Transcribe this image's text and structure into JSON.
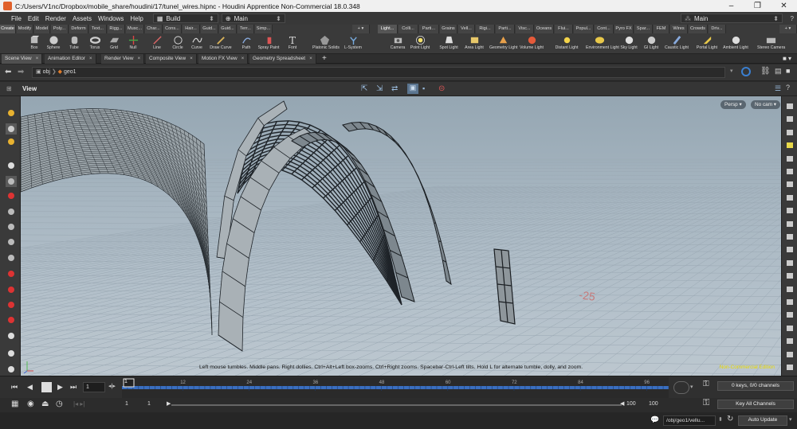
{
  "window": {
    "title": "C:/Users/V1nc/Dropbox/mobile_share/houdini/17/tunel_wires.hipnc - Houdini Apprentice Non-Commercial 18.0.348",
    "minimize": "–",
    "maximize": "❐",
    "close": "✕"
  },
  "menu": {
    "items": [
      "File",
      "Edit",
      "Render",
      "Assets",
      "Windows",
      "Help"
    ],
    "desktop": "Build",
    "desktop_ctx": "Main",
    "right_desktop": "Main"
  },
  "shelf_tabs_left": [
    "Create",
    "Modify",
    "Model",
    "Poly...",
    "Deform",
    "Text...",
    "Rigg...",
    "Musc...",
    "Char...",
    "Cons...",
    "Hair...",
    "Guid...",
    "Guid...",
    "Terr...",
    "Simp..."
  ],
  "shelf_tabs_right": [
    "Light...",
    "Colli...",
    "Parti...",
    "Grains",
    "Vell...",
    "Rigi...",
    "Parti...",
    "Visc...",
    "Oceans",
    "Flui...",
    "Popul...",
    "Cont...",
    "Pyro FX",
    "Spar...",
    "FEM",
    "Wires",
    "Crowds",
    "Driv..."
  ],
  "tools_left": [
    {
      "label": "Box",
      "icon": "box-icon"
    },
    {
      "label": "Sphere",
      "icon": "sphere-icon"
    },
    {
      "label": "Tube",
      "icon": "tube-icon"
    },
    {
      "label": "Torus",
      "icon": "torus-icon"
    },
    {
      "label": "Grid",
      "icon": "grid-icon"
    },
    {
      "label": "Null",
      "icon": "null-icon"
    },
    {
      "label": "Line",
      "icon": "line-icon"
    },
    {
      "label": "Circle",
      "icon": "circle-icon"
    },
    {
      "label": "Curve",
      "icon": "curve-icon"
    },
    {
      "label": "Draw Curve",
      "icon": "draw-curve-icon"
    },
    {
      "label": "Path",
      "icon": "path-icon"
    },
    {
      "label": "Spray Paint",
      "icon": "spray-paint-icon"
    },
    {
      "label": "Font",
      "icon": "font-icon"
    },
    {
      "label": "Platonic Solids",
      "icon": "platonic-icon"
    },
    {
      "label": "L-System",
      "icon": "lsystem-icon"
    }
  ],
  "tools_right": [
    {
      "label": "Camera",
      "icon": "camera-icon"
    },
    {
      "label": "Point Light",
      "icon": "point-light-icon"
    },
    {
      "label": "Spot Light",
      "icon": "spot-light-icon"
    },
    {
      "label": "Area Light",
      "icon": "area-light-icon"
    },
    {
      "label": "Geometry Light",
      "icon": "geometry-light-icon"
    },
    {
      "label": "Volume Light",
      "icon": "volume-light-icon"
    },
    {
      "label": "Distant Light",
      "icon": "distant-light-icon"
    },
    {
      "label": "Environment Light",
      "icon": "environment-light-icon"
    },
    {
      "label": "Sky Light",
      "icon": "sky-light-icon"
    },
    {
      "label": "GI Light",
      "icon": "gi-light-icon"
    },
    {
      "label": "Caustic Light",
      "icon": "caustic-light-icon"
    },
    {
      "label": "Portal Light",
      "icon": "portal-light-icon"
    },
    {
      "label": "Ambient Light",
      "icon": "ambient-light-icon"
    },
    {
      "label": "Stereo Camera",
      "icon": "stereo-camera-icon"
    }
  ],
  "pane_tabs": [
    "Scene View",
    "Animation Editor",
    "Render View",
    "Composite View",
    "Motion FX View",
    "Geometry Spreadsheet"
  ],
  "path": {
    "obj": "obj",
    "geo": "geo1"
  },
  "view": {
    "label": "View",
    "persp": "Persp",
    "cam": "No cam",
    "hint": "Left mouse tumbles. Middle pans. Right dollies. Ctrl+Alt+Left box-zooms. Ctrl+Right zooms. Spacebar-Ctrl-Left tilts. Hold L for alternate tumble, dolly, and zoom.",
    "watermark": "Non-Commercial Edition",
    "grid_label": "-25"
  },
  "timeline": {
    "current_frame": "1",
    "ticks": [
      "12",
      "24",
      "36",
      "48",
      "60",
      "72",
      "84",
      "96"
    ],
    "frame_marker": "1",
    "start": "1",
    "start2": "1",
    "end": "100",
    "end2": "100",
    "keys": "0 keys, 0/0 channels",
    "key_all": "Key All Channels"
  },
  "status": {
    "path": "/obj/geo1/vellu...",
    "update": "Auto Update"
  },
  "colors": {
    "accent": "#e8d800",
    "timeline_blue": "#3a6fc0"
  }
}
